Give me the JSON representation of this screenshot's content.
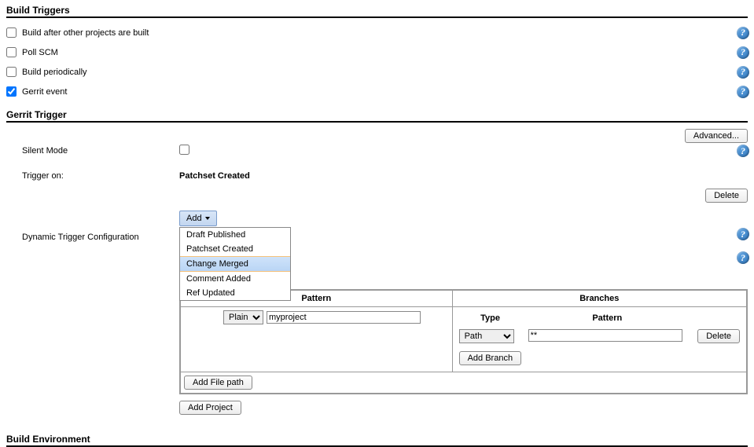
{
  "sections": {
    "build_triggers": "Build Triggers",
    "gerrit_trigger": "Gerrit Trigger",
    "build_environment": "Build Environment"
  },
  "triggers": {
    "build_after": {
      "label": "Build after other projects are built",
      "checked": false
    },
    "poll_scm": {
      "label": "Poll SCM",
      "checked": false
    },
    "periodic": {
      "label": "Build periodically",
      "checked": false
    },
    "gerrit": {
      "label": "Gerrit event",
      "checked": true
    }
  },
  "gerrit": {
    "advanced_btn": "Advanced...",
    "silent_mode_label": "Silent Mode",
    "silent_mode_checked": false,
    "trigger_on_label": "Trigger on:",
    "trigger_on_value": "Patchset Created",
    "delete_btn": "Delete",
    "add_btn": "Add",
    "dyn_trigger_label": "Dynamic Trigger Configuration",
    "dropdown": {
      "items": [
        "Draft Published",
        "Patchset Created",
        "Change Merged",
        "Comment Added",
        "Ref Updated"
      ],
      "highlighted_index": 2
    },
    "project_table": {
      "headers": {
        "pattern": "Pattern",
        "branches": "Branches"
      },
      "row": {
        "type_select": "Plain",
        "pattern_value": "myproject",
        "branch_headers": {
          "type": "Type",
          "pattern": "Pattern"
        },
        "branch_row": {
          "type": "Path",
          "pattern": "**",
          "delete": "Delete"
        },
        "add_branch": "Add Branch"
      },
      "add_file_path": "Add File path",
      "add_project": "Add Project"
    }
  },
  "help_glyph": "?"
}
